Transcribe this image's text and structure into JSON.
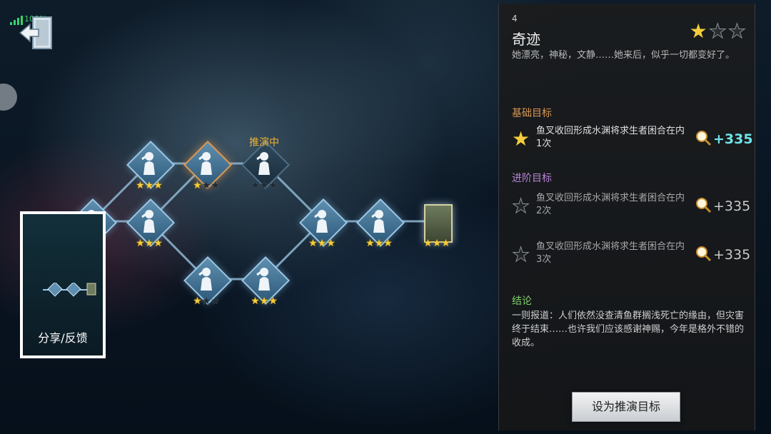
{
  "status": {
    "signal_text": "100%"
  },
  "tree": {
    "active_label": "推演中",
    "nodes": [
      {
        "id": "n-start",
        "stars": 0,
        "state": "normal"
      },
      {
        "id": "n-a1",
        "stars": 3,
        "state": "normal"
      },
      {
        "id": "n-a2",
        "stars": 1,
        "state": "active"
      },
      {
        "id": "n-a3",
        "stars": 0,
        "state": "dim"
      },
      {
        "id": "n-b1",
        "stars": 3,
        "state": "normal"
      },
      {
        "id": "n-c1",
        "stars": 1,
        "state": "normal"
      },
      {
        "id": "n-c2",
        "stars": 3,
        "state": "normal"
      },
      {
        "id": "n-m1",
        "stars": 3,
        "state": "normal"
      },
      {
        "id": "n-m2",
        "stars": 3,
        "state": "normal"
      },
      {
        "id": "n-end",
        "stars": 3,
        "state": "card"
      }
    ]
  },
  "share": {
    "label": "分享/反馈"
  },
  "panel": {
    "number": "4",
    "title": "奇迹",
    "stars_earned": 1,
    "stars_total": 3,
    "description": "她漂亮，神秘，文静……她来后，似乎一切都变好了。",
    "basic_heading": "基础目标",
    "advanced_heading": "进阶目标",
    "goals": [
      {
        "text": "鱼叉收回形成水渊将求生者困合在内1次",
        "reward": "+335",
        "done": true
      },
      {
        "text": "鱼叉收回形成水渊将求生者困合在内2次",
        "reward": "+335",
        "done": false
      },
      {
        "text": "鱼叉收回形成水渊将求生者困合在内3次",
        "reward": "+335",
        "done": false
      }
    ],
    "conclusion_heading": "结论",
    "conclusion": "一则报道：人们依然没查清鱼群搁浅死亡的缘由，但灾害终于结束……也许我们应该感谢神赐，今年是格外不错的收成。",
    "button_label": "设为推演目标"
  },
  "colors": {
    "gold": "#f5cd3a",
    "cyan_reward": "#6fe3e8",
    "basic": "#d99652",
    "advanced": "#b784d6",
    "conclusion": "#7fcf6a"
  }
}
